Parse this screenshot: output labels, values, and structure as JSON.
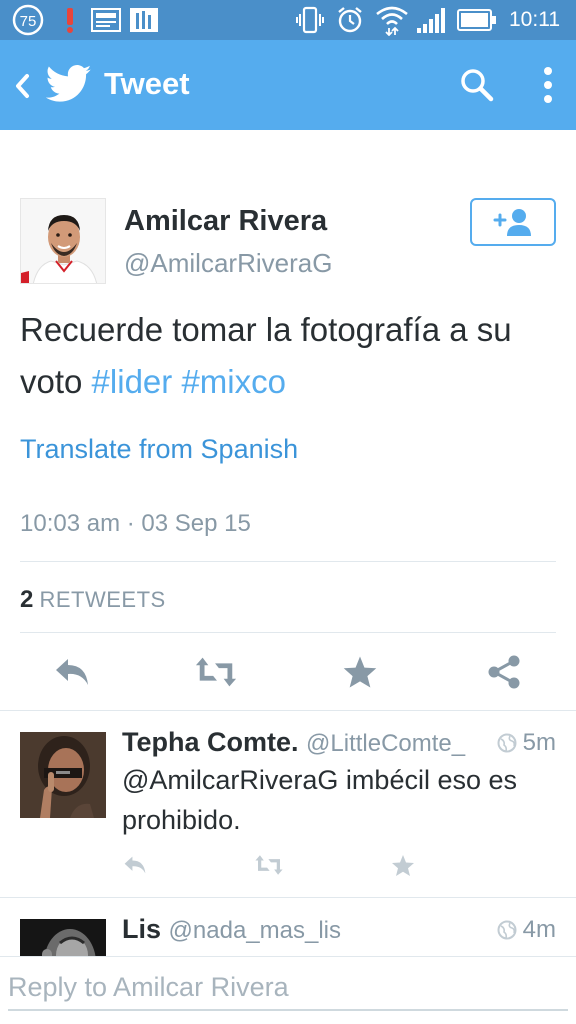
{
  "status_bar": {
    "battery_circle": "75",
    "time": "10:11"
  },
  "app_bar": {
    "title": "Tweet"
  },
  "tweet": {
    "author_name": "Amilcar Rivera",
    "author_handle": "@AmilcarRiveraG",
    "text_plain": "Recuerde tomar la fotografía a su voto ",
    "hashtag_1": "#lider",
    "hashtag_2": "#mixco",
    "translate_label": "Translate from Spanish",
    "timestamp": "10:03 am · 03 Sep 15",
    "retweet_count": "2",
    "retweet_label": "RETWEETS"
  },
  "replies": [
    {
      "name": "Tepha Comte.",
      "handle": "@LittleComte_",
      "time": "5m",
      "text": "@AmilcarRiveraG imbécil eso es prohibido."
    },
    {
      "name": "Lis",
      "handle": "@nada_mas_lis",
      "time": "4m"
    }
  ],
  "reply_box": {
    "placeholder": "Reply to Amilcar Rivera"
  },
  "colors": {
    "status_bar": "#4a8fc9",
    "app_bar": "#55acee",
    "link": "#3b94d9",
    "icon_gray": "#8899a6"
  }
}
